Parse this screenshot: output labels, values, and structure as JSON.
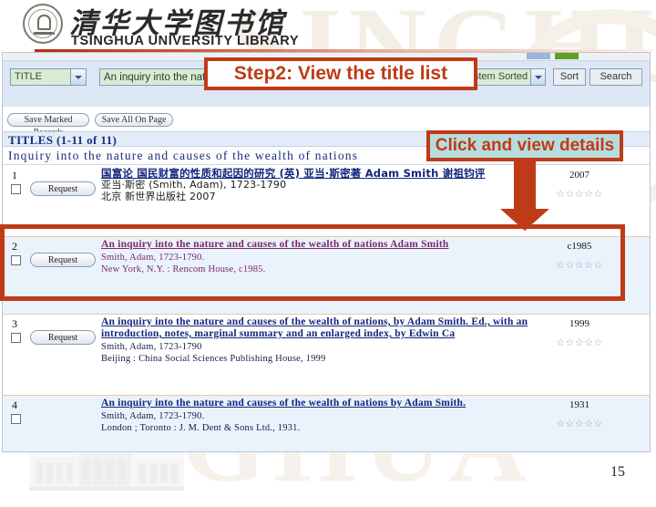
{
  "header": {
    "logo_cn": "清华大学图书馆",
    "logo_en": "TSINGHUA UNIVERSITY LIBRARY",
    "seal_icon": "bell-seal-icon"
  },
  "searchbar": {
    "field_select": "TITLE",
    "field_select_arrow": "chevron-down-icon",
    "query_value": "An inquiry into the nat",
    "query_placeholder": "",
    "sort_select": "System Sorted",
    "sort_select_arrow": "chevron-down-icon",
    "sort_button": "Sort",
    "search_button": "Search"
  },
  "toolbar": {
    "save_marked": "Save Marked Records",
    "save_all": "Save All On Page"
  },
  "results": {
    "header": "TITLES (1-11 of 11)",
    "subheader": "Inquiry into the nature and causes of the wealth of nations",
    "request_label": "Request",
    "records": [
      {
        "num": "1",
        "title": "国富论 国民财富的性质和起因的研究 (英) 亚当·斯密著 Adam Smith 谢祖钧评",
        "title_lang": "cn",
        "author": "亚当·斯密 (Smith, Adam), 1723-1790",
        "publisher": "北京 新世界出版社 2007",
        "date": "2007",
        "stars": "☆☆☆☆☆"
      },
      {
        "num": "2",
        "title": "An inquiry into the nature and causes of the wealth of nations Adam Smith",
        "title_lang": "en",
        "author": "Smith, Adam, 1723-1790.",
        "publisher": "New York, N.Y. : Rencom House, c1985.",
        "date": "c1985",
        "stars": "☆☆☆☆☆"
      },
      {
        "num": "3",
        "title": "An inquiry into the nature and causes of the wealth of nations, by Adam Smith. Ed., with an introduction, notes, marginal summary and an enlarged index, by Edwin Ca",
        "title_lang": "en",
        "author": "Smith, Adam, 1723-1790",
        "publisher": "Beijing : China Social Sciences Publishing House, 1999",
        "date": "1999",
        "stars": "☆☆☆☆☆"
      },
      {
        "num": "4",
        "title": "An inquiry into the nature and causes of the wealth of nations by Adam Smith.",
        "title_lang": "en",
        "author": "Smith, Adam, 1723-1790.",
        "publisher": "London ; Toronto : J. M. Dent & Sons Ltd., 1931.",
        "date": "1931",
        "stars": "☆☆☆☆☆"
      }
    ]
  },
  "annotations": {
    "step_callout": "Step2: View the title  list",
    "click_callout": "Click and view details",
    "accent_color": "#bf3b17",
    "click_callout_bg": "#b7dcdd"
  },
  "footer": {
    "page_number": "15"
  },
  "watermark": {
    "text_1": "SINGHUA",
    "text_2": "GHUA"
  }
}
